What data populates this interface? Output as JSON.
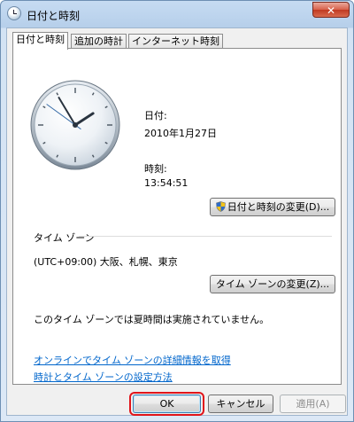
{
  "window": {
    "title": "日付と時刻",
    "close_symbol": "✕"
  },
  "tabs": [
    {
      "label": "日付と時刻",
      "active": true
    },
    {
      "label": "追加の時計",
      "active": false
    },
    {
      "label": "インターネット時刻",
      "active": false
    }
  ],
  "date": {
    "label": "日付:",
    "value": "2010年1月27日"
  },
  "time": {
    "label": "時刻:",
    "value": "13:54:51"
  },
  "change_datetime_button": "日付と時刻の変更(D)...",
  "timezone": {
    "header": "タイム ゾーン",
    "value": "(UTC+09:00) 大阪、札幌、東京",
    "change_button": "タイム ゾーンの変更(Z)...",
    "dst_message": "このタイム ゾーンでは夏時間は実施されていません。"
  },
  "links": {
    "timezone_info": "オンラインでタイム ゾーンの詳細情報を取得",
    "how_to_set": "時計とタイム ゾーンの設定方法"
  },
  "buttons": {
    "ok": "OK",
    "cancel": "キャンセル",
    "apply": "適用(A)"
  },
  "colors": {
    "link": "#0066cc",
    "highlight": "#e0141a",
    "close_button": "#c03a21"
  },
  "icons": {
    "app": "clock-icon",
    "uac": "uac-shield-icon",
    "close": "close-icon"
  }
}
